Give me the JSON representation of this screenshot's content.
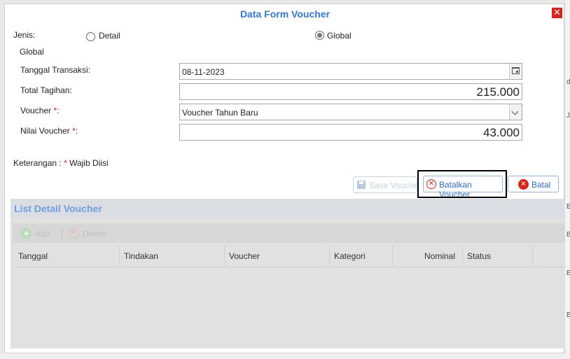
{
  "dialog": {
    "title": "Data Form Voucher",
    "close_glyph": "✕"
  },
  "form": {
    "jenis_label": "Jenis:",
    "radio_detail": "Detail",
    "radio_global": "Global",
    "selected": "Global",
    "section_label": "Global",
    "tanggal_label": "Tanggal Transaksi:",
    "tanggal_value": "08-11-2023",
    "total_label": "Total Tagihan:",
    "total_value": "215.000",
    "voucher_label": "Voucher ",
    "voucher_value": "Voucher Tahun Baru",
    "nilai_label": "Nilai Voucher ",
    "nilai_value": "43.000",
    "required_mark": "*",
    "required_colon": ":",
    "keterangan_prefix": "Keterangan : ",
    "keterangan_text": " Wajib Diisi"
  },
  "buttons": {
    "save": "Save Voucher",
    "batalkan": "Batalkan Voucher",
    "batal": "Batal"
  },
  "panel": {
    "title": "List Detail Voucher",
    "toolbar": {
      "add": "Add",
      "delete": "Delete"
    },
    "columns": [
      "Tanggal",
      "Tindakan",
      "Voucher",
      "Kategori",
      "Nominal",
      "Status"
    ]
  },
  "background": {
    "right_letters": [
      "d",
      "Je",
      "B",
      "B",
      "B",
      "B"
    ]
  },
  "colors": {
    "accent": "#2f7ad8",
    "danger": "#d9241c",
    "panel_title": "#6f9ee3"
  },
  "icons": {
    "close": "close-icon",
    "calendar": "calendar-icon",
    "dropdown": "chevron-down-icon",
    "save": "save-icon",
    "cancel": "x-circle-icon",
    "batal": "x-solid-icon",
    "add": "add-icon",
    "delete": "delete-icon"
  }
}
